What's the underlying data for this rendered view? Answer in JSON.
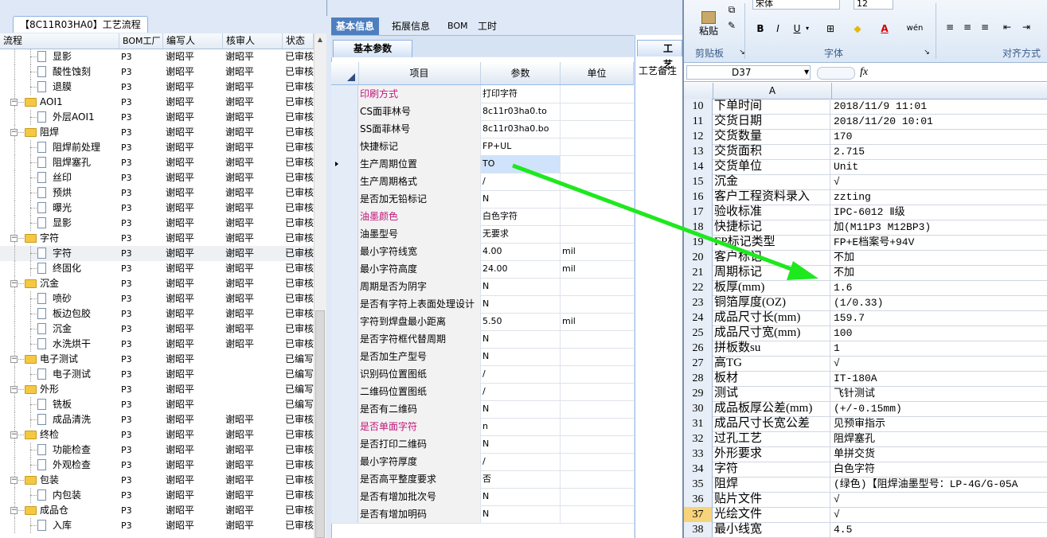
{
  "tree": {
    "tab_title": "【8C11R03HA0】工艺流程",
    "headers": [
      "流程",
      "BOM工厂",
      "编写人",
      "核审人",
      "状态"
    ],
    "rows": [
      {
        "level": 2,
        "type": "doc",
        "name": "显影",
        "bom": "P3",
        "writer": "谢昭平",
        "reviewer": "谢昭平",
        "status": "已审核"
      },
      {
        "level": 2,
        "type": "doc",
        "name": "酸性蚀刻",
        "bom": "P3",
        "writer": "谢昭平",
        "reviewer": "谢昭平",
        "status": "已审核"
      },
      {
        "level": 2,
        "type": "doc",
        "name": "退膜",
        "bom": "P3",
        "writer": "谢昭平",
        "reviewer": "谢昭平",
        "status": "已审核"
      },
      {
        "level": 1,
        "type": "folder",
        "name": "AOI1",
        "bom": "P3",
        "writer": "谢昭平",
        "reviewer": "谢昭平",
        "status": "已审核"
      },
      {
        "level": 2,
        "type": "doc",
        "name": "外层AOI1",
        "bom": "P3",
        "writer": "谢昭平",
        "reviewer": "谢昭平",
        "status": "已审核"
      },
      {
        "level": 1,
        "type": "folder",
        "name": "阻焊",
        "bom": "P3",
        "writer": "谢昭平",
        "reviewer": "谢昭平",
        "status": "已审核"
      },
      {
        "level": 2,
        "type": "doc",
        "name": "阻焊前处理",
        "bom": "P3",
        "writer": "谢昭平",
        "reviewer": "谢昭平",
        "status": "已审核"
      },
      {
        "level": 2,
        "type": "doc",
        "name": "阻焊塞孔",
        "bom": "P3",
        "writer": "谢昭平",
        "reviewer": "谢昭平",
        "status": "已审核"
      },
      {
        "level": 2,
        "type": "doc",
        "name": "丝印",
        "bom": "P3",
        "writer": "谢昭平",
        "reviewer": "谢昭平",
        "status": "已审核"
      },
      {
        "level": 2,
        "type": "doc",
        "name": "预烘",
        "bom": "P3",
        "writer": "谢昭平",
        "reviewer": "谢昭平",
        "status": "已审核"
      },
      {
        "level": 2,
        "type": "doc",
        "name": "曝光",
        "bom": "P3",
        "writer": "谢昭平",
        "reviewer": "谢昭平",
        "status": "已审核"
      },
      {
        "level": 2,
        "type": "doc",
        "name": "显影",
        "bom": "P3",
        "writer": "谢昭平",
        "reviewer": "谢昭平",
        "status": "已审核"
      },
      {
        "level": 1,
        "type": "folder",
        "name": "字符",
        "bom": "P3",
        "writer": "谢昭平",
        "reviewer": "谢昭平",
        "status": "已审核"
      },
      {
        "level": 2,
        "type": "doc",
        "name": "字符",
        "bom": "P3",
        "writer": "谢昭平",
        "reviewer": "谢昭平",
        "status": "已审核",
        "selected": true
      },
      {
        "level": 2,
        "type": "doc",
        "name": "终固化",
        "bom": "P3",
        "writer": "谢昭平",
        "reviewer": "谢昭平",
        "status": "已审核"
      },
      {
        "level": 1,
        "type": "folder",
        "name": "沉金",
        "bom": "P3",
        "writer": "谢昭平",
        "reviewer": "谢昭平",
        "status": "已审核"
      },
      {
        "level": 2,
        "type": "doc",
        "name": "喷砂",
        "bom": "P3",
        "writer": "谢昭平",
        "reviewer": "谢昭平",
        "status": "已审核"
      },
      {
        "level": 2,
        "type": "doc",
        "name": "板边包胶",
        "bom": "P3",
        "writer": "谢昭平",
        "reviewer": "谢昭平",
        "status": "已审核"
      },
      {
        "level": 2,
        "type": "doc",
        "name": "沉金",
        "bom": "P3",
        "writer": "谢昭平",
        "reviewer": "谢昭平",
        "status": "已审核"
      },
      {
        "level": 2,
        "type": "doc",
        "name": "水洗烘干",
        "bom": "P3",
        "writer": "谢昭平",
        "reviewer": "谢昭平",
        "status": "已审核"
      },
      {
        "level": 1,
        "type": "folder",
        "name": "电子测试",
        "bom": "P3",
        "writer": "谢昭平",
        "reviewer": "",
        "status": "已编写"
      },
      {
        "level": 2,
        "type": "doc",
        "name": "电子测试",
        "bom": "P3",
        "writer": "谢昭平",
        "reviewer": "",
        "status": "已编写"
      },
      {
        "level": 1,
        "type": "folder",
        "name": "外形",
        "bom": "P3",
        "writer": "谢昭平",
        "reviewer": "",
        "status": "已编写"
      },
      {
        "level": 2,
        "type": "doc",
        "name": "铣板",
        "bom": "P3",
        "writer": "谢昭平",
        "reviewer": "",
        "status": "已编写"
      },
      {
        "level": 2,
        "type": "doc",
        "name": "成品清洗",
        "bom": "P3",
        "writer": "谢昭平",
        "reviewer": "谢昭平",
        "status": "已审核"
      },
      {
        "level": 1,
        "type": "folder",
        "name": "终检",
        "bom": "P3",
        "writer": "谢昭平",
        "reviewer": "谢昭平",
        "status": "已审核"
      },
      {
        "level": 2,
        "type": "doc",
        "name": "功能检查",
        "bom": "P3",
        "writer": "谢昭平",
        "reviewer": "谢昭平",
        "status": "已审核"
      },
      {
        "level": 2,
        "type": "doc",
        "name": "外观检查",
        "bom": "P3",
        "writer": "谢昭平",
        "reviewer": "谢昭平",
        "status": "已审核"
      },
      {
        "level": 1,
        "type": "folder",
        "name": "包装",
        "bom": "P3",
        "writer": "谢昭平",
        "reviewer": "谢昭平",
        "status": "已审核"
      },
      {
        "level": 2,
        "type": "doc",
        "name": "内包装",
        "bom": "P3",
        "writer": "谢昭平",
        "reviewer": "谢昭平",
        "status": "已审核"
      },
      {
        "level": 1,
        "type": "folder",
        "name": "成品仓",
        "bom": "P3",
        "writer": "谢昭平",
        "reviewer": "谢昭平",
        "status": "已审核"
      },
      {
        "level": 2,
        "type": "doc",
        "name": "入库",
        "bom": "P3",
        "writer": "谢昭平",
        "reviewer": "谢昭平",
        "status": "已审核"
      }
    ]
  },
  "main_tabs": [
    "基本信息",
    "拓展信息",
    "BOM",
    "工时"
  ],
  "sub_tab": "基本参数",
  "remark_tab": "工艺",
  "remark_label": "工艺备注",
  "grid": {
    "headers": [
      "项目",
      "参数",
      "单位"
    ],
    "rows": [
      {
        "item": "印刷方式",
        "param": "打印字符",
        "unit": "",
        "pink": true
      },
      {
        "item": "CS面菲林号",
        "param": "8c11r03ha0.to",
        "unit": ""
      },
      {
        "item": "SS面菲林号",
        "param": "8c11r03ha0.bo",
        "unit": ""
      },
      {
        "item": "快捷标记",
        "param": "FP+UL",
        "unit": ""
      },
      {
        "item": "生产周期位置",
        "param": "TO",
        "unit": "",
        "current": true
      },
      {
        "item": "生产周期格式",
        "param": "/",
        "unit": ""
      },
      {
        "item": "是否加无铅标记",
        "param": "N",
        "unit": ""
      },
      {
        "item": "油墨颜色",
        "param": "白色字符",
        "unit": "",
        "pink": true
      },
      {
        "item": "油墨型号",
        "param": "无要求",
        "unit": ""
      },
      {
        "item": "最小字符线宽",
        "param": "4.00",
        "unit": "mil"
      },
      {
        "item": "最小字符高度",
        "param": "24.00",
        "unit": "mil"
      },
      {
        "item": "周期是否为阴字",
        "param": "N",
        "unit": ""
      },
      {
        "item": "是否有字符上表面处理设计",
        "param": "N",
        "unit": ""
      },
      {
        "item": "字符到焊盘最小距离",
        "param": "5.50",
        "unit": "mil"
      },
      {
        "item": "是否字符框代替周期",
        "param": "N",
        "unit": ""
      },
      {
        "item": "是否加生产型号",
        "param": "N",
        "unit": ""
      },
      {
        "item": "识别码位置图纸",
        "param": "/",
        "unit": ""
      },
      {
        "item": "二维码位置图纸",
        "param": "/",
        "unit": ""
      },
      {
        "item": "是否有二维码",
        "param": "N",
        "unit": ""
      },
      {
        "item": "是否单面字符",
        "param": "n",
        "unit": "",
        "pink": true
      },
      {
        "item": "是否打印二维码",
        "param": "N",
        "unit": ""
      },
      {
        "item": "最小字符厚度",
        "param": "/",
        "unit": ""
      },
      {
        "item": "是否高平整度要求",
        "param": "否",
        "unit": ""
      },
      {
        "item": "是否有增加批次号",
        "param": "N",
        "unit": ""
      },
      {
        "item": "是否有增加明码",
        "param": "N",
        "unit": ""
      }
    ]
  },
  "excel": {
    "ribbon": {
      "paste": "粘贴",
      "clipboard": "剪贴板",
      "font_group": "字体",
      "align_group": "对齐方式",
      "font_name": "宋体",
      "font_size": "12",
      "bold": "B",
      "italic": "I",
      "underline": "U",
      "wen": "wén"
    },
    "name_box": "D37",
    "fx": "fx",
    "column_a": "A",
    "rows": [
      {
        "num": "10",
        "a": "下单时间",
        "b": "2018/11/9 11:01"
      },
      {
        "num": "11",
        "a": "交货日期",
        "b": "2018/11/20 10:01"
      },
      {
        "num": "12",
        "a": "交货数量",
        "b": "170"
      },
      {
        "num": "13",
        "a": "交货面积",
        "b": "2.715"
      },
      {
        "num": "14",
        "a": "交货单位",
        "b": "Unit"
      },
      {
        "num": "15",
        "a": "沉金",
        "b": "√"
      },
      {
        "num": "16",
        "a": "客户工程资料录入",
        "b": "zzting"
      },
      {
        "num": "17",
        "a": "验收标准",
        "b": "IPC-6012 Ⅱ级"
      },
      {
        "num": "18",
        "a": "快捷标记",
        "b": "加(M11P3 M12BP3)"
      },
      {
        "num": "19",
        "a": "FP标记类型",
        "b": "FP+E档案号+94V"
      },
      {
        "num": "20",
        "a": "客户标记",
        "b": "不加"
      },
      {
        "num": "21",
        "a": "周期标记",
        "b": "不加"
      },
      {
        "num": "22",
        "a": "板厚(mm)",
        "b": "1.6"
      },
      {
        "num": "23",
        "a": "铜箔厚度(OZ)",
        "b": "(1/0.33)"
      },
      {
        "num": "24",
        "a": "成品尺寸长(mm)",
        "b": "159.7"
      },
      {
        "num": "25",
        "a": "成品尺寸宽(mm)",
        "b": "100"
      },
      {
        "num": "26",
        "a": "拼板数su",
        "b": "1"
      },
      {
        "num": "27",
        "a": "高TG",
        "b": "√"
      },
      {
        "num": "28",
        "a": "板材",
        "b": "IT-180A"
      },
      {
        "num": "29",
        "a": "测试",
        "b": "飞针测试"
      },
      {
        "num": "30",
        "a": "成品板厚公差(mm)",
        "b": "(+/-0.15mm)"
      },
      {
        "num": "31",
        "a": "成品尺寸长宽公差",
        "b": "见预审指示"
      },
      {
        "num": "32",
        "a": "过孔工艺",
        "b": "阻焊塞孔"
      },
      {
        "num": "33",
        "a": "外形要求",
        "b": "单拼交货"
      },
      {
        "num": "34",
        "a": "字符",
        "b": "白色字符"
      },
      {
        "num": "35",
        "a": "阻焊",
        "b": "(绿色)【阻焊油墨型号：LP-4G/G-05A"
      },
      {
        "num": "36",
        "a": "贴片文件",
        "b": "√"
      },
      {
        "num": "37",
        "a": "光绘文件",
        "b": "√",
        "active": true
      },
      {
        "num": "38",
        "a": "最小线宽",
        "b": "4.5"
      }
    ]
  },
  "colors": {
    "arrow": "#1ee81e",
    "pink_label": "#c0157b",
    "tab_active": "#4d7fbf",
    "active_row_header": "#f7d37c"
  }
}
